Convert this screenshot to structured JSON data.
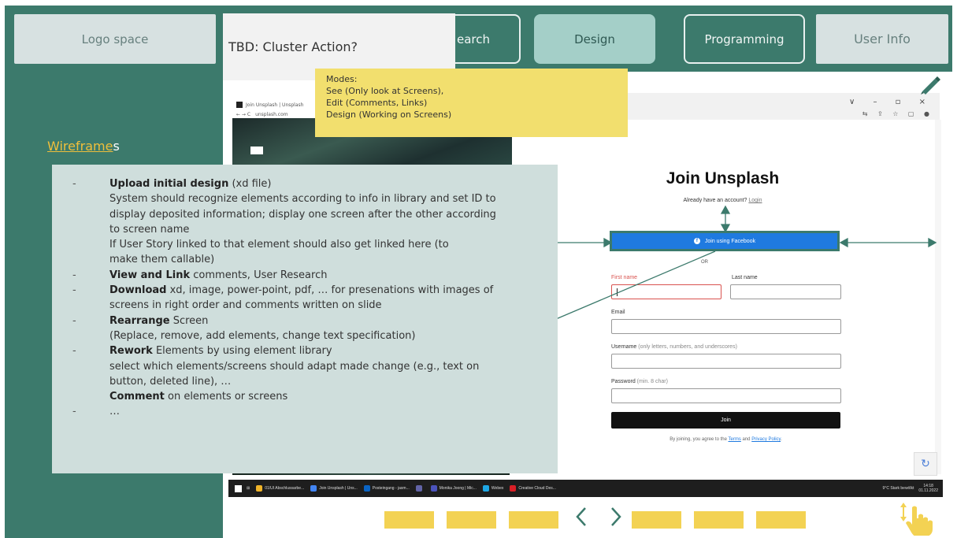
{
  "nav": {
    "logo": "Logo space",
    "research": "earch",
    "design": "Design",
    "programming": "Programming",
    "user_info": "User Info"
  },
  "tbd": "TBD: Cluster Action?",
  "modes": {
    "lines": [
      "Modes:",
      "See (Only look at Screens),",
      "Edit (Comments, Links)",
      "Design (Working on Screens)"
    ]
  },
  "sidebar": {
    "wireframes_underlined": "Wireframe",
    "wireframes_rest": "s"
  },
  "description": {
    "item1_bold": "Upload initial design",
    "item1_rest": " (xd file)",
    "item1_lines": [
      "System should recognize elements according to info in library and set ID to",
      "display deposited information; display one screen after the other according",
      "to screen name",
      " If User Story linked to that element should also get linked here (to",
      " make them callable)"
    ],
    "item2_bold": "View and Link",
    "item2_rest": " comments, User Research",
    "item3_bold": "Download",
    "item3_rest": " xd, image, power-point, pdf, … for presenations with images of",
    "item3_line2": "screens in right order and comments written on slide",
    "item4_bold": "Rearrange",
    "item4_rest": " Screen",
    "item4_line2": "(Replace, remove, add elements, change text specification)",
    "item5_bold": "Rework",
    "item5_rest": " Elements by using element library",
    "item5_line2": "select which elements/screens should adapt made change (e.g., text on",
    "item5_line3": "button, deleted line), …",
    "item5_bold2": "Comment",
    "item5_rest2": " on elements or screens",
    "item6": "…",
    "dash": "-"
  },
  "browser": {
    "bg_tab_title": "Join Unsplash | Unsplash",
    "bg_url": "unsplash.com",
    "window_controls": "∨ – ▫ ×",
    "nav_arrows": "← → C",
    "toolbar_icons": "⇆ ⇪ ☆ ▢ ●"
  },
  "form": {
    "title": "Join Unsplash",
    "have_account": "Already have an account? ",
    "login": "Login",
    "facebook_button": "Join using Facebook",
    "or": "OR",
    "first_name": "First name",
    "last_name": "Last name",
    "email": "Email",
    "username": "Username",
    "username_hint": " (only letters, numbers, and underscores)",
    "password": "Password",
    "password_hint": " (min. 8 char)",
    "join_button": "Join",
    "terms_prefix": "By joining, you agree to the ",
    "terms": "Terms",
    "and": " and ",
    "privacy": "Privacy Policy",
    "terms_suffix": "."
  },
  "taskbar": {
    "items": [
      {
        "label": "01/UI Abschlussarbe...",
        "color": "#f0b429"
      },
      {
        "label": "Join Unsplash | Uns...",
        "color": "#4285f4"
      },
      {
        "label": "Posteingang - jasm...",
        "color": "#0a64c4"
      },
      {
        "label": "",
        "color": "#6264a7"
      },
      {
        "label": "Monika Joong | Mic...",
        "color": "#4b53bc"
      },
      {
        "label": "Webex",
        "color": "#1ea7e4"
      },
      {
        "label": "Creative Cloud Des...",
        "color": "#da1f26"
      }
    ],
    "weather": "9°C  Stark bewölkt",
    "time": "14:18",
    "date": "01.11.2022"
  },
  "colors": {
    "teal": "#3c7a6c",
    "light_teal": "#a4cfc8",
    "panel": "#cfdedc",
    "note_yellow": "#f2df6e",
    "thumb_yellow": "#f3d253"
  },
  "icons": {
    "pencil": "pencil-icon",
    "hand": "hand-swipe-icon",
    "prev": "chevron-left-icon",
    "next": "chevron-right-icon"
  }
}
